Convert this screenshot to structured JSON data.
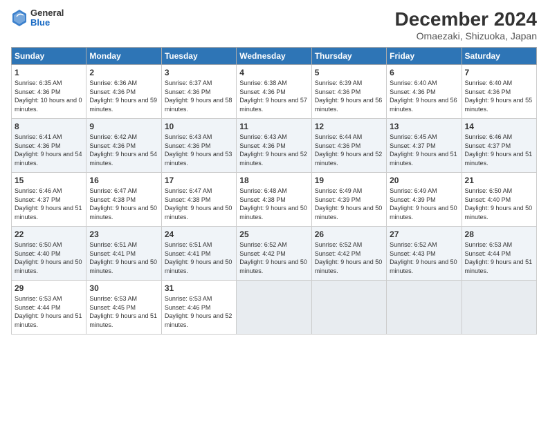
{
  "header": {
    "logo_general": "General",
    "logo_blue": "Blue",
    "month_title": "December 2024",
    "location": "Omaezaki, Shizuoka, Japan"
  },
  "days_of_week": [
    "Sunday",
    "Monday",
    "Tuesday",
    "Wednesday",
    "Thursday",
    "Friday",
    "Saturday"
  ],
  "weeks": [
    [
      {
        "day": "1",
        "sunrise": "6:35 AM",
        "sunset": "4:36 PM",
        "daylight": "10 hours and 0 minutes."
      },
      {
        "day": "2",
        "sunrise": "6:36 AM",
        "sunset": "4:36 PM",
        "daylight": "9 hours and 59 minutes."
      },
      {
        "day": "3",
        "sunrise": "6:37 AM",
        "sunset": "4:36 PM",
        "daylight": "9 hours and 58 minutes."
      },
      {
        "day": "4",
        "sunrise": "6:38 AM",
        "sunset": "4:36 PM",
        "daylight": "9 hours and 57 minutes."
      },
      {
        "day": "5",
        "sunrise": "6:39 AM",
        "sunset": "4:36 PM",
        "daylight": "9 hours and 56 minutes."
      },
      {
        "day": "6",
        "sunrise": "6:40 AM",
        "sunset": "4:36 PM",
        "daylight": "9 hours and 56 minutes."
      },
      {
        "day": "7",
        "sunrise": "6:40 AM",
        "sunset": "4:36 PM",
        "daylight": "9 hours and 55 minutes."
      }
    ],
    [
      {
        "day": "8",
        "sunrise": "6:41 AM",
        "sunset": "4:36 PM",
        "daylight": "9 hours and 54 minutes."
      },
      {
        "day": "9",
        "sunrise": "6:42 AM",
        "sunset": "4:36 PM",
        "daylight": "9 hours and 54 minutes."
      },
      {
        "day": "10",
        "sunrise": "6:43 AM",
        "sunset": "4:36 PM",
        "daylight": "9 hours and 53 minutes."
      },
      {
        "day": "11",
        "sunrise": "6:43 AM",
        "sunset": "4:36 PM",
        "daylight": "9 hours and 52 minutes."
      },
      {
        "day": "12",
        "sunrise": "6:44 AM",
        "sunset": "4:36 PM",
        "daylight": "9 hours and 52 minutes."
      },
      {
        "day": "13",
        "sunrise": "6:45 AM",
        "sunset": "4:37 PM",
        "daylight": "9 hours and 51 minutes."
      },
      {
        "day": "14",
        "sunrise": "6:46 AM",
        "sunset": "4:37 PM",
        "daylight": "9 hours and 51 minutes."
      }
    ],
    [
      {
        "day": "15",
        "sunrise": "6:46 AM",
        "sunset": "4:37 PM",
        "daylight": "9 hours and 51 minutes."
      },
      {
        "day": "16",
        "sunrise": "6:47 AM",
        "sunset": "4:38 PM",
        "daylight": "9 hours and 50 minutes."
      },
      {
        "day": "17",
        "sunrise": "6:47 AM",
        "sunset": "4:38 PM",
        "daylight": "9 hours and 50 minutes."
      },
      {
        "day": "18",
        "sunrise": "6:48 AM",
        "sunset": "4:38 PM",
        "daylight": "9 hours and 50 minutes."
      },
      {
        "day": "19",
        "sunrise": "6:49 AM",
        "sunset": "4:39 PM",
        "daylight": "9 hours and 50 minutes."
      },
      {
        "day": "20",
        "sunrise": "6:49 AM",
        "sunset": "4:39 PM",
        "daylight": "9 hours and 50 minutes."
      },
      {
        "day": "21",
        "sunrise": "6:50 AM",
        "sunset": "4:40 PM",
        "daylight": "9 hours and 50 minutes."
      }
    ],
    [
      {
        "day": "22",
        "sunrise": "6:50 AM",
        "sunset": "4:40 PM",
        "daylight": "9 hours and 50 minutes."
      },
      {
        "day": "23",
        "sunrise": "6:51 AM",
        "sunset": "4:41 PM",
        "daylight": "9 hours and 50 minutes."
      },
      {
        "day": "24",
        "sunrise": "6:51 AM",
        "sunset": "4:41 PM",
        "daylight": "9 hours and 50 minutes."
      },
      {
        "day": "25",
        "sunrise": "6:52 AM",
        "sunset": "4:42 PM",
        "daylight": "9 hours and 50 minutes."
      },
      {
        "day": "26",
        "sunrise": "6:52 AM",
        "sunset": "4:42 PM",
        "daylight": "9 hours and 50 minutes."
      },
      {
        "day": "27",
        "sunrise": "6:52 AM",
        "sunset": "4:43 PM",
        "daylight": "9 hours and 50 minutes."
      },
      {
        "day": "28",
        "sunrise": "6:53 AM",
        "sunset": "4:44 PM",
        "daylight": "9 hours and 51 minutes."
      }
    ],
    [
      {
        "day": "29",
        "sunrise": "6:53 AM",
        "sunset": "4:44 PM",
        "daylight": "9 hours and 51 minutes."
      },
      {
        "day": "30",
        "sunrise": "6:53 AM",
        "sunset": "4:45 PM",
        "daylight": "9 hours and 51 minutes."
      },
      {
        "day": "31",
        "sunrise": "6:53 AM",
        "sunset": "4:46 PM",
        "daylight": "9 hours and 52 minutes."
      },
      null,
      null,
      null,
      null
    ]
  ]
}
